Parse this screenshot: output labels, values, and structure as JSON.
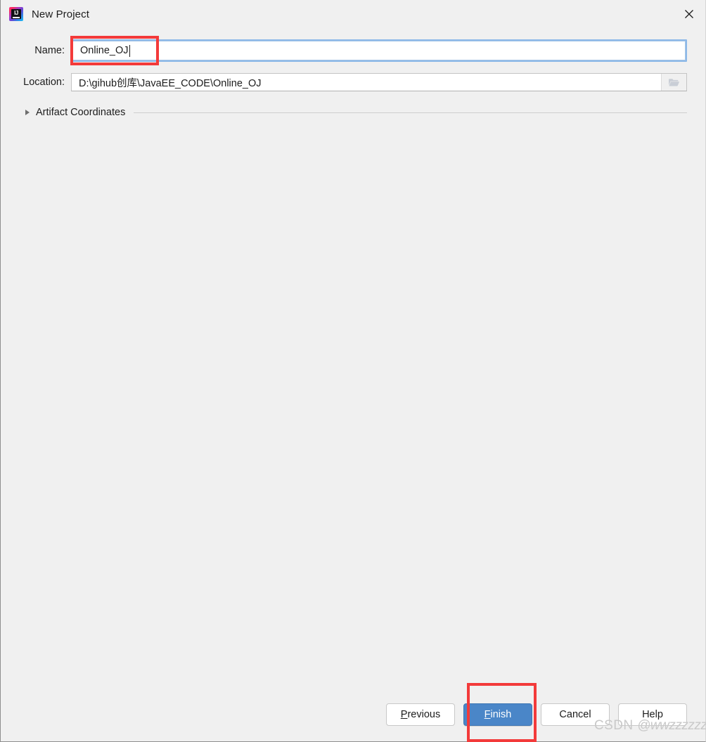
{
  "window": {
    "title": "New Project",
    "app_icon": "intellij-idea-icon",
    "close_icon": "close-icon"
  },
  "form": {
    "name": {
      "label": "Name:",
      "value": "Online_OJ",
      "placeholder": ""
    },
    "location": {
      "label": "Location:",
      "value": "D:\\gihub创库\\JavaEE_CODE\\Online_OJ",
      "placeholder": "",
      "browse_icon": "folder-icon"
    },
    "artifact": {
      "label": "Artifact Coordinates",
      "expander_icon": "chevron-right-icon",
      "expanded": "false"
    }
  },
  "footer": {
    "buttons": [
      {
        "label": "Previous",
        "mnemonic": "P",
        "primary": "false"
      },
      {
        "label": "Finish",
        "mnemonic": "F",
        "primary": "true"
      },
      {
        "label": "Cancel",
        "mnemonic": "",
        "primary": "false"
      },
      {
        "label": "Help",
        "mnemonic": "",
        "primary": "false"
      }
    ],
    "previous_pre": "",
    "previous_mn": "P",
    "previous_post": "revious",
    "finish_pre": "",
    "finish_mn": "F",
    "finish_post": "inish",
    "cancel_label": "Cancel",
    "help_label": "Help"
  },
  "annotations": {
    "name_field_highlight": "red-rectangle",
    "finish_button_highlight": "red-rectangle"
  },
  "watermark": {
    "brand": "CSDN",
    "handle": "@wwzzzzzzzz"
  },
  "colors": {
    "accent": "#4a86c8",
    "annotation": "#f33a3a",
    "dialog_bg": "#f0f0f0",
    "focus_ring": "#8cb8e8"
  }
}
